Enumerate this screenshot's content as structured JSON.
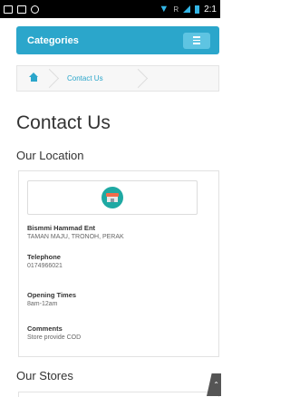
{
  "status_bar": {
    "icons": [
      "image-icon",
      "note-icon",
      "android-icon"
    ],
    "right_icons": [
      "wifi-icon",
      "signal-icon",
      "battery-icon"
    ],
    "roaming": "R",
    "time": "2:1"
  },
  "categories": {
    "title": "Categories",
    "menu_icon": "hamburger-icon",
    "accent_color": "#2ba6cb"
  },
  "breadcrumb": {
    "home_icon": "home-icon",
    "current": "Contact Us"
  },
  "page": {
    "title": "Contact Us"
  },
  "location": {
    "section_title": "Our Location",
    "store_icon": "shop-icon",
    "name": "Bismmi Hammad Ent",
    "address": "TAMAN MAJU, TRONOH, PERAK",
    "telephone_label": "Telephone",
    "telephone": "0174966021",
    "opening_label": "Opening Times",
    "opening": "8am-12am",
    "comments_label": "Comments",
    "comments": "Store provide COD"
  },
  "stores": {
    "section_title": "Our Stores"
  },
  "scroll_top": {
    "icon": "back-to-top-icon",
    "glyph": "⌃"
  }
}
